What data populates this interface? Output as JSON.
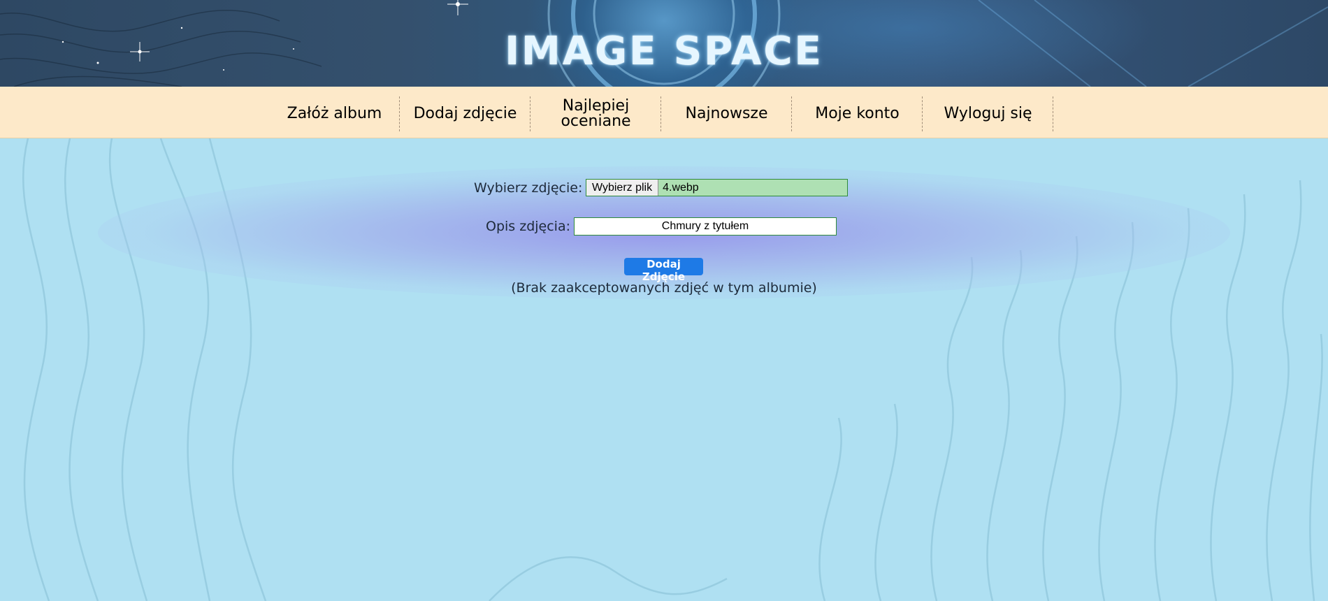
{
  "header": {
    "logo_text": "IMAGE SPACE"
  },
  "nav": {
    "items": [
      {
        "label": "Załóż album"
      },
      {
        "label": "Dodaj zdjęcie"
      },
      {
        "label": "Najlepiej oceniane"
      },
      {
        "label": "Najnowsze"
      },
      {
        "label": "Moje konto"
      },
      {
        "label": "Wyloguj się"
      }
    ]
  },
  "form": {
    "file_label": "Wybierz zdjęcie:",
    "file_button_label": "Wybierz plik",
    "file_name": "4.webp",
    "description_label": "Opis zdjęcia:",
    "description_value": "Chmury z tytułem",
    "submit_label": "Dodaj Zdjęcie"
  },
  "status": {
    "empty_message": "(Brak zaakceptowanych zdjęć w tym albumie)"
  },
  "colors": {
    "nav_background": "#fde9c9",
    "page_background": "#afe0f2",
    "accent_button": "#1e7ae6",
    "input_border": "#2f8a3a"
  }
}
